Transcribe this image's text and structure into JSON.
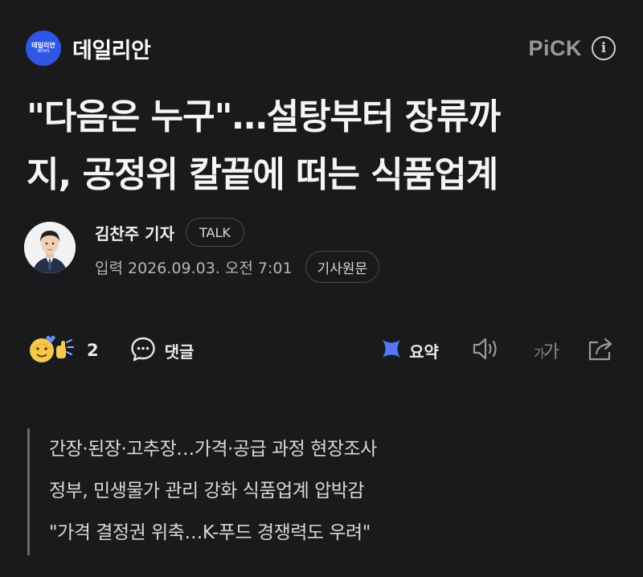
{
  "press": {
    "logo_text": "데일리안",
    "logo_sub": "NEWS",
    "name": "데일리안",
    "pick_label": "PiCK",
    "info_label": "i"
  },
  "article": {
    "headline_line1": "\"다음은 누구\"…설탕부터 장류까",
    "headline_line2": "지, 공정위 칼끝에 떠는 식품업계",
    "reporter": "김찬주 기자",
    "talk_label": "TALK",
    "dateline": "입력 2026.09.03. 오전 7:01",
    "original_label": "기사원문"
  },
  "toolbar": {
    "reaction_count": "2",
    "comment_label": "댓글",
    "summary_label": "요약",
    "font_label_small": "가",
    "font_label_large": "가",
    "icons": [
      "reaction-emoji-icon",
      "comment-bubble-icon",
      "ai-summary-icon",
      "speaker-icon",
      "font-size-icon",
      "share-icon"
    ]
  },
  "lede": [
    "간장·된장·고추장…가격·공급 과정 현장조사",
    "정부, 민생물가 관리 강화 식품업계 압박감",
    "\"가격 결정권 위축…K-푸드 경쟁력도 우려\""
  ],
  "colors": {
    "background": "#1a1a1c",
    "logo_blue": "#2f57e6",
    "summary_blue": "#4d7cf5",
    "summary_purple": "#8a5cf0"
  }
}
